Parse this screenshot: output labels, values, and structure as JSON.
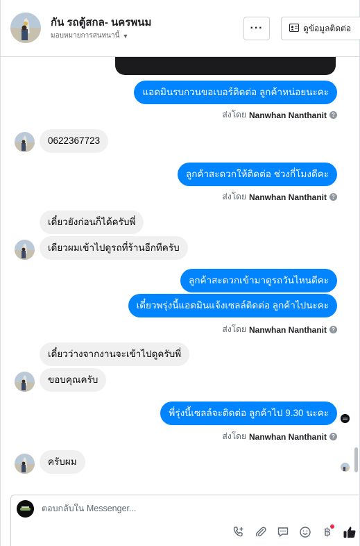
{
  "header": {
    "title": "กัน รถตู้สกล- นครพนม",
    "subtitle": "มอบหมายการสนทนานี้",
    "more_label": "···",
    "contact_label": "ดูข้อมูลติดต่อ"
  },
  "messages": [
    {
      "side": "out",
      "text": "แอดมินรบกวนขอเบอร์ติดต่อ ลูกค้าหน่อยนะคะ"
    },
    {
      "side": "in",
      "text": "0622367723"
    },
    {
      "side": "out",
      "text": "ลูกค้าสะดวกให้ติดต่อ ช่วงกี่โมงดีคะ"
    },
    {
      "side": "in",
      "text": "เดี๋ยวยังก่อนก็ได้ครับพี่"
    },
    {
      "side": "in",
      "text": "เดียวผมเข้าไปดูรถที่ร้านอีกทีครับ"
    },
    {
      "side": "out",
      "text": "ลูกค้าสะดวกเข้ามาดูรถวันไหนดีคะ"
    },
    {
      "side": "out",
      "text": "เดี๋ยวพรุ่งนี้แอดมินแจ้งเซลล์ติดต่อ ลูกค้าไปนะคะ"
    },
    {
      "side": "in",
      "text": "เดี๋ยวว่างจากงานจะเข้าไปดูครับพี่"
    },
    {
      "side": "in",
      "text": "ขอบคุณครับ"
    },
    {
      "side": "out",
      "text": "พี่รุ่งนี้เซลล์จะติดต่อ ลูกค้าไป 9.30 นะคะ"
    },
    {
      "side": "in",
      "text": "ครับผม"
    }
  ],
  "sent_by": {
    "prefix": "ส่งโดย",
    "name": "Nanwhan Nanthanit",
    "help": "?"
  },
  "composer": {
    "placeholder": "ตอบกลับใน Messenger..."
  },
  "icons": {
    "more": "ellipsis-icon",
    "contact": "contact-card-icon",
    "call": "add-call-icon",
    "attach": "paperclip-icon",
    "saved_replies": "chat-bubble-icon",
    "emoji": "smiley-icon",
    "payment": "baht-icon",
    "like": "thumbs-up-icon"
  },
  "colors": {
    "outgoing_bubble": "#0084ff",
    "incoming_bubble": "#f0f0f0",
    "notification": "#f02849"
  }
}
